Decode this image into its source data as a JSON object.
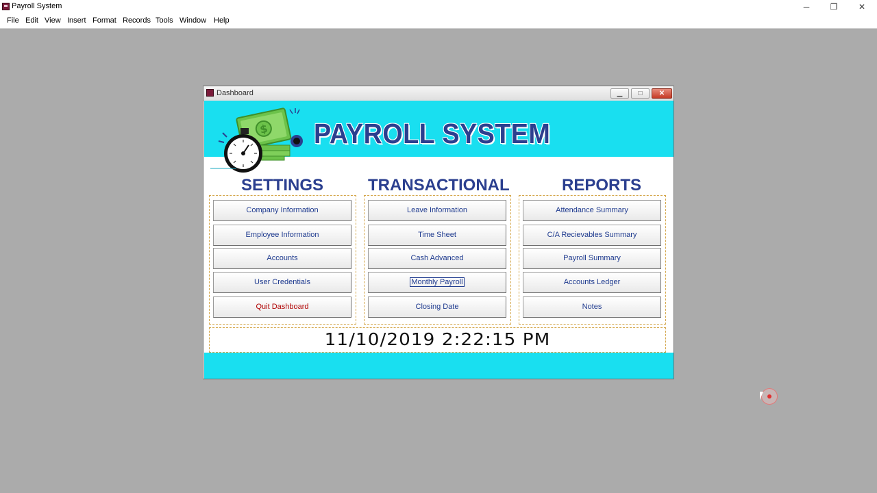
{
  "app": {
    "title": "Payroll System",
    "controls": {
      "minimize": "─",
      "restore": "❐",
      "close": "✕"
    }
  },
  "menu": [
    "File",
    "Edit",
    "View",
    "Insert",
    "Format",
    "Records",
    "Tools",
    "Window",
    "Help"
  ],
  "dashboard": {
    "window_title": "Dashboard",
    "controls": {
      "minimize": "▁",
      "maximize": "□",
      "close": "✕"
    },
    "banner_title": "PAYROLL SYSTEM",
    "logo_icon": "stopwatch-money-icon",
    "colors": {
      "banner": "#19dff0",
      "heading": "#2b3f8f",
      "button_text": "#1f3b8f",
      "quit_text": "#b00000",
      "group_border": "#d4a64a"
    },
    "sections": {
      "settings": {
        "heading": "SETTINGS",
        "buttons": [
          "Company Information",
          "Employee Information",
          "Accounts",
          "User Credentials",
          "Quit Dashboard"
        ]
      },
      "transactional": {
        "heading": "TRANSACTIONAL",
        "buttons": [
          "Leave Information",
          "Time Sheet",
          "Cash Advanced",
          "Monthly Payroll",
          "Closing Date"
        ],
        "focused": "Monthly Payroll"
      },
      "reports": {
        "heading": "REPORTS",
        "buttons": [
          "Attendance Summary",
          "C/A Recievables Summary",
          "Payroll Summary",
          "Accounts Ledger",
          "Notes"
        ]
      }
    },
    "clock": "11/10/2019 2:22:15 PM"
  }
}
